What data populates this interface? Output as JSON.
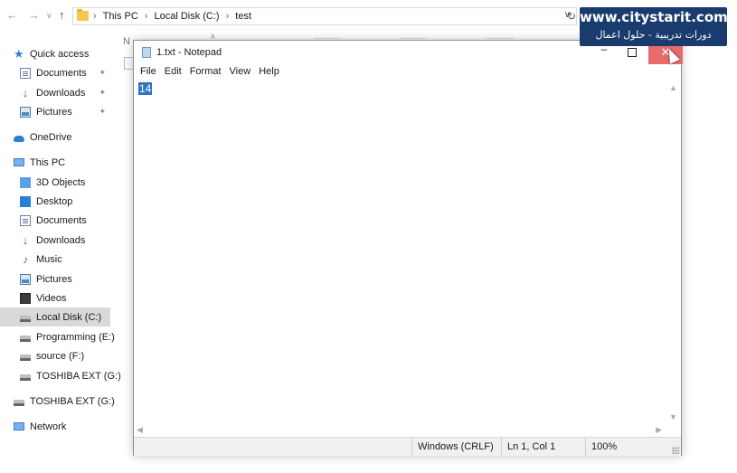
{
  "address_bar": {
    "back_icon": "arrow-left-icon",
    "forward_icon": "arrow-right-icon",
    "recent_icon": "chevron-down-icon",
    "up_icon": "arrow-up-icon",
    "crumbs": [
      "This PC",
      "Local Disk (C:)",
      "test"
    ],
    "refresh_icon": "refresh-icon"
  },
  "navigation": {
    "quick_access": {
      "label": "Quick access",
      "items": [
        {
          "label": "Documents",
          "pinned": true
        },
        {
          "label": "Downloads",
          "pinned": true
        },
        {
          "label": "Pictures",
          "pinned": true
        }
      ]
    },
    "onedrive": "OneDrive",
    "this_pc": {
      "label": "This PC",
      "items": [
        "3D Objects",
        "Desktop",
        "Documents",
        "Downloads",
        "Music",
        "Pictures",
        "Videos",
        "Local Disk (C:)",
        "Programming (E:)",
        "source (F:)",
        "TOSHIBA EXT (G:)"
      ],
      "selected": "Local Disk (C:)"
    },
    "external_drive": "TOSHIBA EXT (G:)",
    "network": "Network"
  },
  "explorer_content": {
    "column_fragment": "N"
  },
  "notepad": {
    "title": "1.txt - Notepad",
    "menu": [
      "File",
      "Edit",
      "Format",
      "View",
      "Help"
    ],
    "text": "14",
    "status": {
      "encoding": "Windows (CRLF)",
      "position": "Ln 1, Col 1",
      "zoom": "100%"
    },
    "close_color": "#e86a6a"
  },
  "watermark": {
    "site": "www.citystarit.com",
    "tagline": "دورات تدريبية - حلول اعمال",
    "background": "#193b6e"
  }
}
